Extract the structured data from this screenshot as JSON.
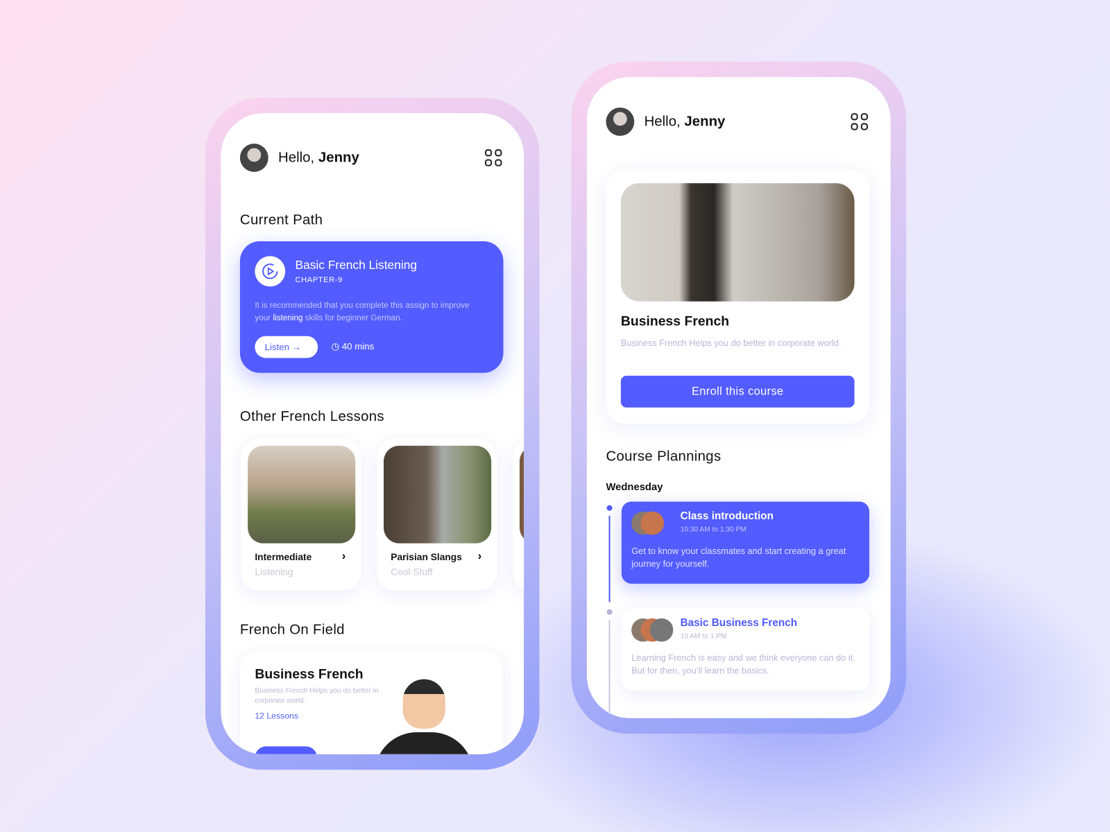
{
  "left_phone": {
    "greeting": "Hello,",
    "user": "Jenny",
    "current_path": {
      "heading": "Current Path",
      "title": "Basic French Listening",
      "chapter": "CHAPTER-9",
      "desc_before": "It is recommended that you complete this assign to improve your ",
      "desc_highlight": "listening",
      "desc_after": " skills for beginner German.",
      "listen_label": "Listen",
      "duration": "40 mins"
    },
    "other_heading": "Other French Lessons",
    "lessons": [
      {
        "title": "Intermediate",
        "subtitle": "Listening"
      },
      {
        "title": "Parisian Slangs",
        "subtitle": "Cool Stuff"
      }
    ],
    "field_heading": "French On Field",
    "field_card": {
      "title": "Business French",
      "desc": "Business French Helps you do better in corporate world.",
      "lessons": "12 Lessons"
    }
  },
  "right_phone": {
    "greeting": "Hello,",
    "user": "Jenny",
    "course": {
      "title": "Business French",
      "desc": "Business French Helps you do better in corporate world.",
      "enroll_label": "Enroll this course"
    },
    "plannings_heading": "Course Plannings",
    "day": "Wednesday",
    "events": [
      {
        "title": "Class introduction",
        "time": "10:30 AM to 1:30 PM",
        "desc": "Get to know your classmates and start creating a great journey for yourself."
      },
      {
        "title": "Basic Business French",
        "time": "10 AM to 1 PM",
        "desc": "Learning French is easy and we think everyone can do it. But for then, you’ll learn the basics."
      }
    ]
  },
  "colors": {
    "accent": "#525cff"
  }
}
